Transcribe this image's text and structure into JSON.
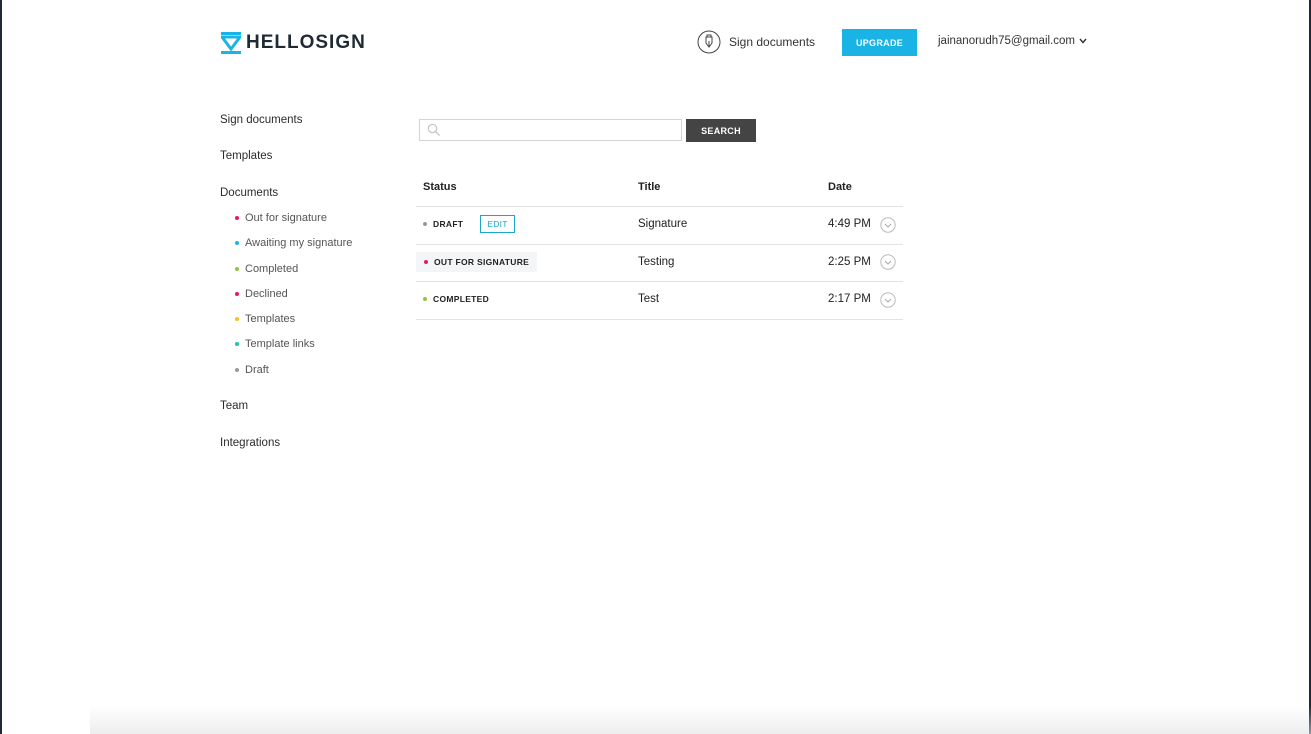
{
  "header": {
    "logo_text": "HELLOSIGN",
    "sign_label": "Sign documents",
    "upgrade_label": "UPGRADE",
    "account_email": "jainanorudh75@gmail.com"
  },
  "sidebar": {
    "items": [
      {
        "label": "Sign documents"
      },
      {
        "label": "Templates"
      },
      {
        "label": "Documents"
      },
      {
        "label": "Team"
      },
      {
        "label": "Integrations"
      }
    ],
    "documents_sub": [
      {
        "label": "Out for signature",
        "color": "#e5186e"
      },
      {
        "label": "Awaiting my signature",
        "color": "#1ab3e6"
      },
      {
        "label": "Completed",
        "color": "#8cc63f"
      },
      {
        "label": "Declined",
        "color": "#e5186e"
      },
      {
        "label": "Templates",
        "color": "#f5c518"
      },
      {
        "label": "Template links",
        "color": "#20c4b4"
      },
      {
        "label": "Draft",
        "color": "#9a9a9a"
      }
    ]
  },
  "search": {
    "placeholder": "",
    "button_label": "SEARCH"
  },
  "table": {
    "headers": [
      "Status",
      "Title",
      "Date"
    ],
    "rows": [
      {
        "status": "DRAFT",
        "status_color": "#9a9a9a",
        "action": "EDIT",
        "title": "Signature",
        "date": "4:49 PM"
      },
      {
        "status": "OUT FOR SIGNATURE",
        "status_color": "#e5186e",
        "title": "Testing",
        "date": "2:25 PM"
      },
      {
        "status": "COMPLETED",
        "status_color": "#8cc63f",
        "title": "Test",
        "date": "2:17 PM"
      }
    ]
  },
  "colors": {
    "accent": "#1ab3e6",
    "dark": "#1f2a36",
    "search_button": "#444444"
  }
}
